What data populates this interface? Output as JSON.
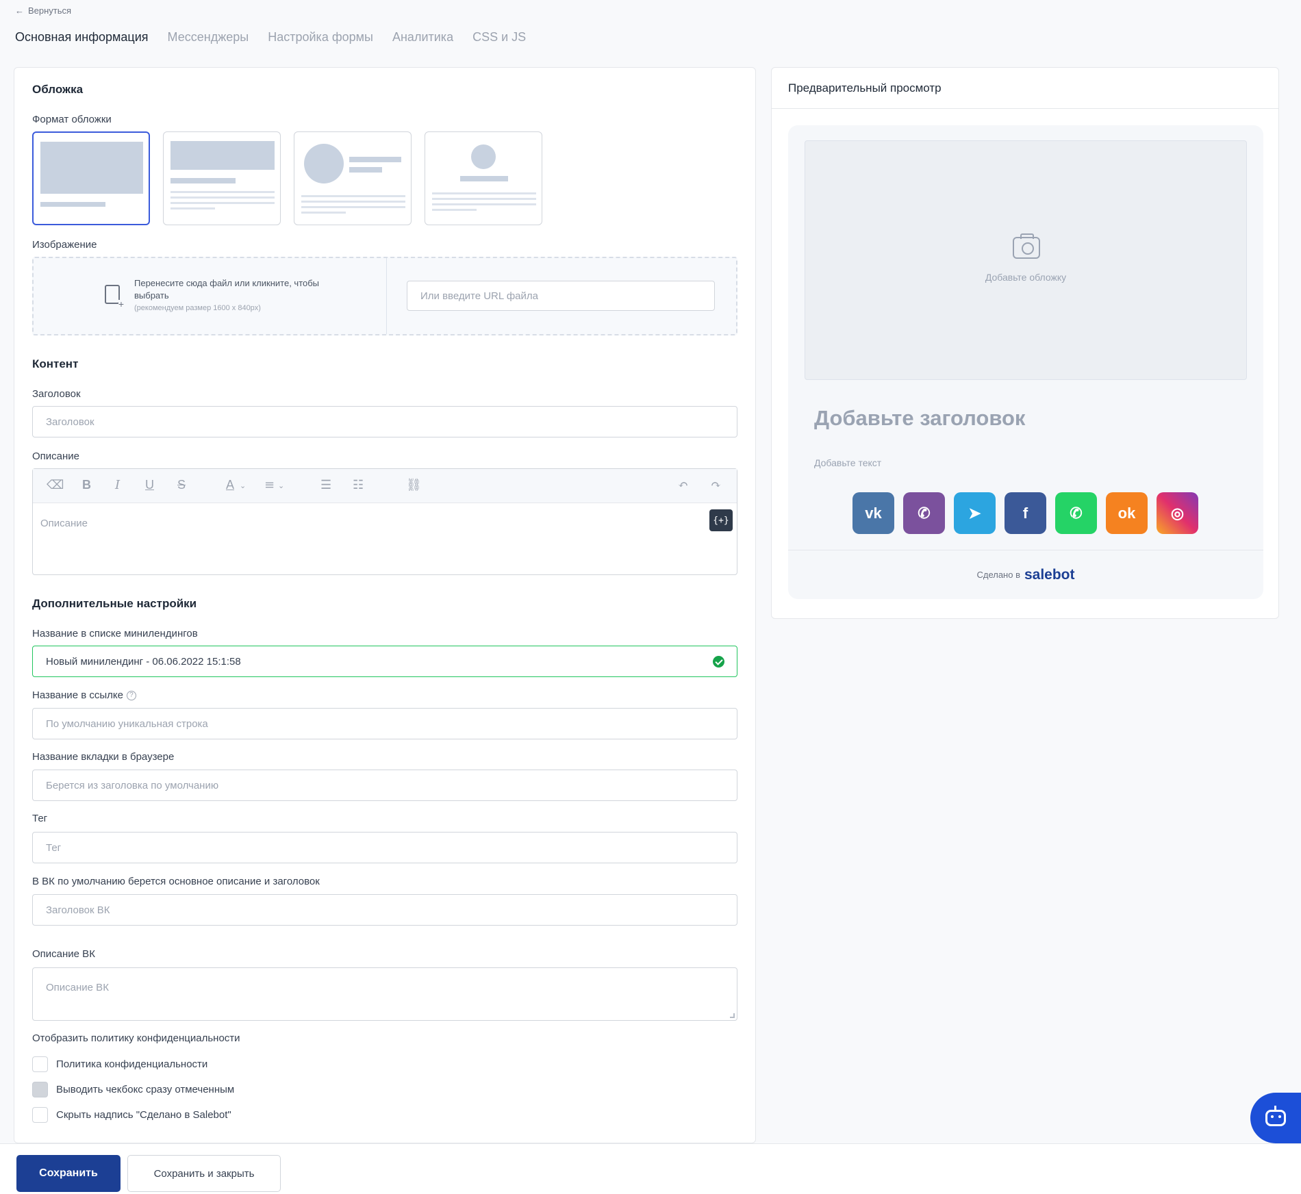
{
  "nav": {
    "back_label": "Вернуться",
    "tabs": [
      {
        "label": "Основная информация",
        "active": true
      },
      {
        "label": "Мессенджеры",
        "active": false
      },
      {
        "label": "Настройка формы",
        "active": false
      },
      {
        "label": "Аналитика",
        "active": false
      },
      {
        "label": "CSS и JS",
        "active": false
      }
    ]
  },
  "cover": {
    "section_title": "Обложка",
    "format_label": "Формат обложки",
    "format_options": [
      "wide-image",
      "image-top-text",
      "avatar-left",
      "avatar-center"
    ],
    "selected_format": 0,
    "image_label": "Изображение",
    "dropzone_text": "Перенесите сюда файл или кликните, чтобы выбрать",
    "dropzone_hint": "(рекомендуем размер 1600 x 840px)",
    "url_placeholder": "Или введите URL файла"
  },
  "content": {
    "section_title": "Контент",
    "title_label": "Заголовок",
    "title_placeholder": "Заголовок",
    "description_label": "Описание",
    "description_placeholder": "Описание",
    "variable_button": "{+}"
  },
  "extra": {
    "section_title": "Дополнительные настройки",
    "list_name_label": "Название в списке минилендингов",
    "list_name_value": "Новый минилендинг - 06.06.2022 15:1:58",
    "link_name_label": "Название в ссылке",
    "link_name_placeholder": "По умолчанию уникальная строка",
    "tab_name_label": "Название вкладки в браузере",
    "tab_name_placeholder": "Берется из заголовка по умолчанию",
    "tag_label": "Тег",
    "tag_placeholder": "Тег",
    "vk_label": "В ВК по умолчанию берется основное описание и заголовок",
    "vk_title_placeholder": "Заголовок ВК",
    "vk_desc_label": "Описание ВК",
    "vk_desc_placeholder": "Описание ВК",
    "privacy_label": "Отобразить политику конфиденциальности",
    "checkboxes": [
      {
        "label": "Политика конфиденциальности",
        "checked": false,
        "disabled": false
      },
      {
        "label": "Выводить чекбокс сразу отмеченным",
        "checked": false,
        "disabled": true
      },
      {
        "label": "Скрыть надпись \"Сделано в Salebot\"",
        "checked": false,
        "disabled": false
      }
    ]
  },
  "actions": {
    "save": "Сохранить",
    "save_close": "Сохранить и закрыть"
  },
  "preview": {
    "header": "Предварительный просмотр",
    "cover_placeholder": "Добавьте обложку",
    "title_placeholder": "Добавьте заголовок",
    "text_placeholder": "Добавьте текст",
    "socials": [
      {
        "name": "vk",
        "glyph": "vk",
        "color": "#4a76a8"
      },
      {
        "name": "viber",
        "glyph": "✆",
        "color": "#7b519d"
      },
      {
        "name": "telegram",
        "glyph": "➤",
        "color": "#2ca5e0"
      },
      {
        "name": "facebook",
        "glyph": "f",
        "color": "#3b5998"
      },
      {
        "name": "whatsapp",
        "glyph": "✆",
        "color": "#25d366"
      },
      {
        "name": "odnoklassniki",
        "glyph": "ok",
        "color": "#f58220"
      },
      {
        "name": "instagram",
        "glyph": "◎",
        "color": "#c13584"
      }
    ],
    "footer_text": "Сделано в",
    "brand": "salebot"
  },
  "colors": {
    "accent": "#1c3f94",
    "selected_border": "#3b5bdb",
    "success": "#16a34a"
  }
}
